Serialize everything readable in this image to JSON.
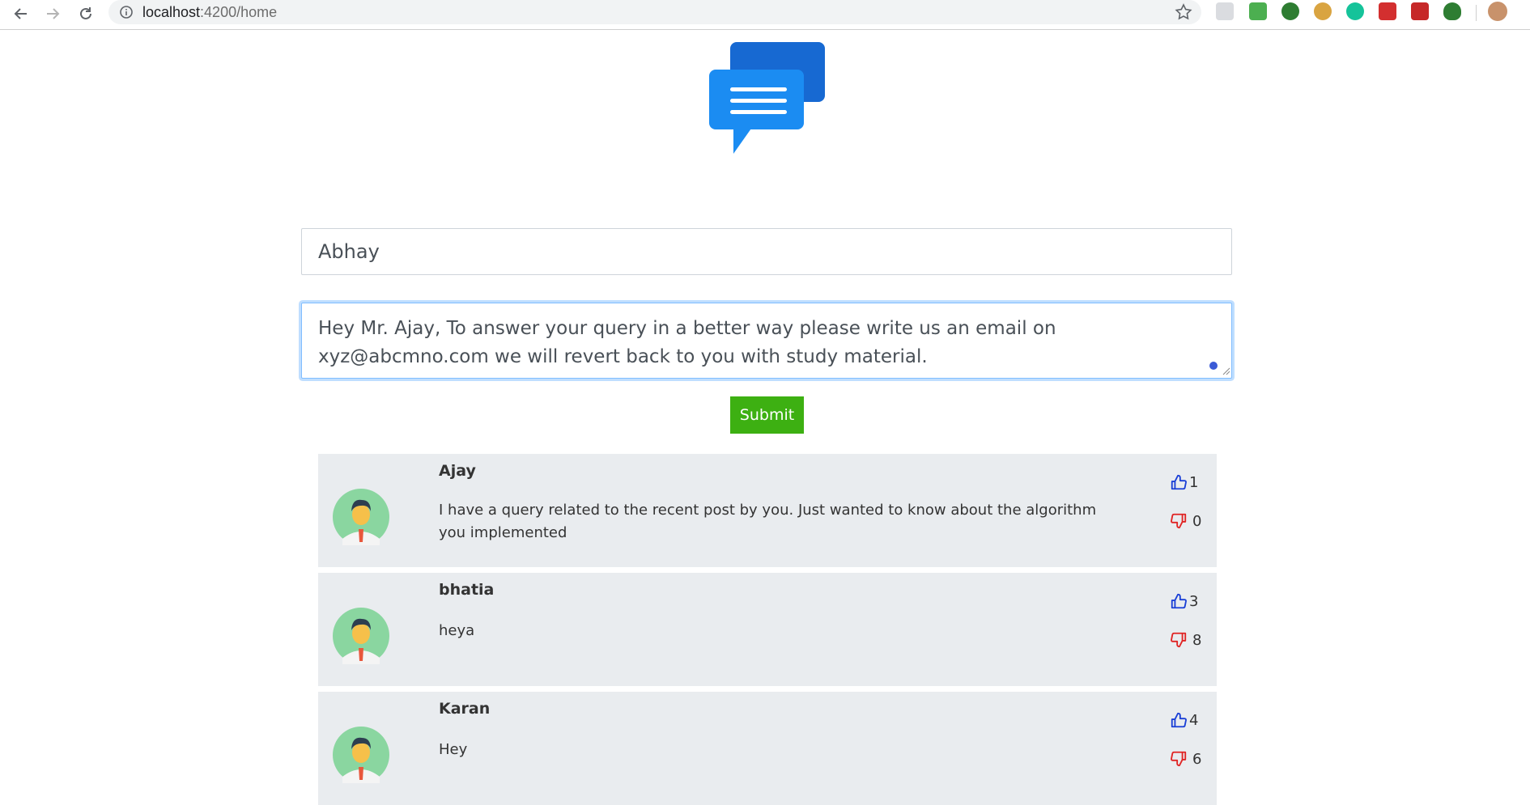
{
  "browser": {
    "url_host": "localhost",
    "url_path": ":4200/home"
  },
  "form": {
    "name_value": "Abhay",
    "message_value": "Hey Mr. Ajay, To answer your query in a better way please write us an email on xyz@abcmno.com we will revert back to you with study material.",
    "submit_label": "Submit"
  },
  "comments": [
    {
      "name": "Ajay",
      "text": "I have a query related to the recent post by you. Just wanted to know about the algorithm you implemented",
      "likes": "1",
      "dislikes": "0"
    },
    {
      "name": "bhatia",
      "text": "heya",
      "likes": "3",
      "dislikes": "8"
    },
    {
      "name": "Karan",
      "text": "Hey",
      "likes": "4",
      "dislikes": "6"
    }
  ],
  "colors": {
    "submit": "#3db012",
    "like": "#1a3fd6",
    "dislike": "#e02424",
    "card": "#e9ecef"
  }
}
